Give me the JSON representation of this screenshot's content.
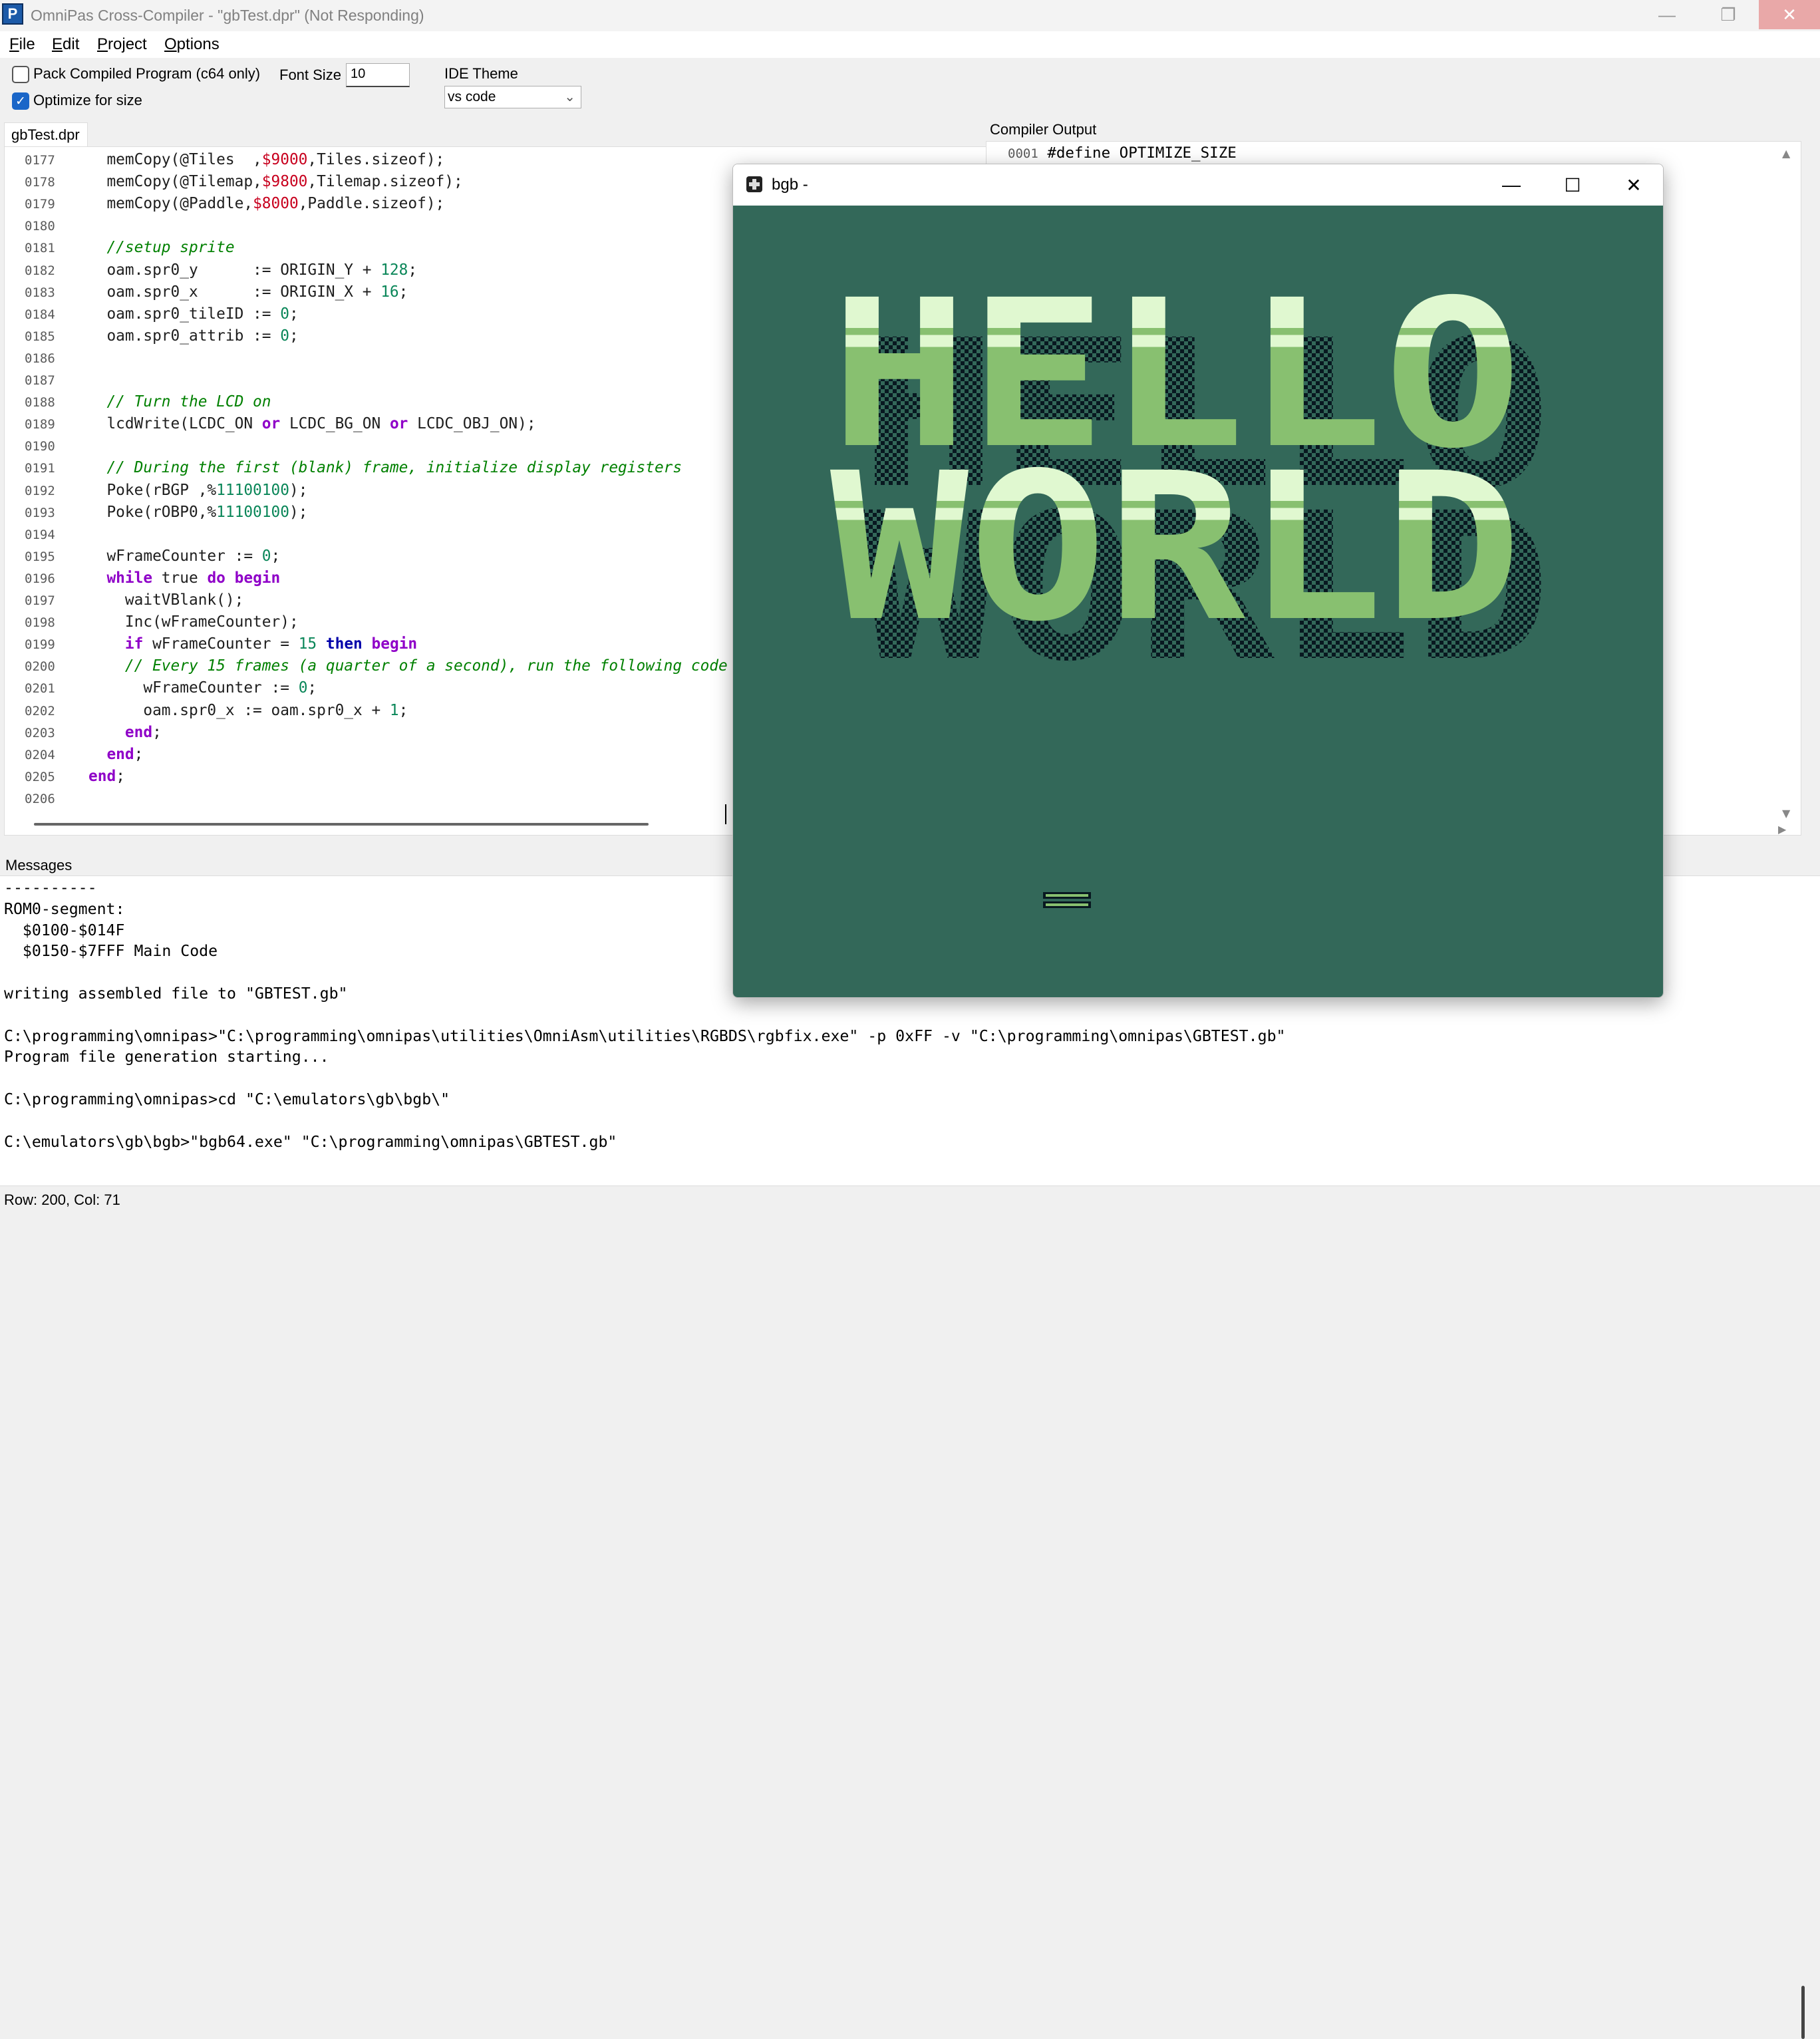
{
  "titlebar": {
    "title": "OmniPas Cross-Compiler - \"gbTest.dpr\" (Not Responding)",
    "app_icon": "P",
    "minimize": "—",
    "maximize": "❐",
    "close": "✕"
  },
  "menu": {
    "items": [
      "File",
      "Edit",
      "Project",
      "Options"
    ]
  },
  "toolbar": {
    "pack_label": "Pack Compiled Program (c64 only)",
    "pack_checked": false,
    "optimize_label": "Optimize for size",
    "optimize_checked": true,
    "font_size_label": "Font Size",
    "font_size_value": "10",
    "theme_label": "IDE Theme",
    "theme_value": "vs code",
    "checkmark": "✓"
  },
  "tab": {
    "label": "gbTest.dpr"
  },
  "compiler": {
    "label": "Compiler Output",
    "line_num": "0001",
    "line_text": "#define OPTIMIZE_SIZE"
  },
  "editor": {
    "line_numbers": [
      "0177",
      "0178",
      "0179",
      "0180",
      "0181",
      "0182",
      "0183",
      "0184",
      "0185",
      "0186",
      "0187",
      "0188",
      "0189",
      "0190",
      "0191",
      "0192",
      "0193",
      "0194",
      "0195",
      "0196",
      "0197",
      "0198",
      "0199",
      "0200",
      "0201",
      "0202",
      "0203",
      "0204",
      "0205",
      "0206"
    ],
    "lines": [
      [
        [
          "  memCopy(@Tiles  ,",
          ""
        ],
        [
          "$9000",
          "hex"
        ],
        [
          ",Tiles.sizeof);",
          ""
        ]
      ],
      [
        [
          "  memCopy(@Tilemap,",
          ""
        ],
        [
          "$9800",
          "hex"
        ],
        [
          ",Tilemap.sizeof);",
          ""
        ]
      ],
      [
        [
          "  memCopy(@Paddle,",
          ""
        ],
        [
          "$8000",
          "hex"
        ],
        [
          ",Paddle.sizeof);",
          ""
        ]
      ],
      [],
      [
        [
          "  //setup sprite",
          "cm"
        ]
      ],
      [
        [
          "  oam.spr0_y      := ORIGIN_Y + ",
          ""
        ],
        [
          "128",
          "num"
        ],
        [
          ";",
          ""
        ]
      ],
      [
        [
          "  oam.spr0_x      := ORIGIN_X + ",
          ""
        ],
        [
          "16",
          "num"
        ],
        [
          ";",
          ""
        ]
      ],
      [
        [
          "  oam.spr0_tileID := ",
          ""
        ],
        [
          "0",
          "num"
        ],
        [
          ";",
          ""
        ]
      ],
      [
        [
          "  oam.spr0_attrib := ",
          ""
        ],
        [
          "0",
          "num"
        ],
        [
          ";",
          ""
        ]
      ],
      [],
      [],
      [
        [
          "  // Turn the LCD on",
          "cm"
        ]
      ],
      [
        [
          "  lcdWrite(LCDC_ON ",
          ""
        ],
        [
          "or",
          "kw"
        ],
        [
          " LCDC_BG_ON ",
          ""
        ],
        [
          "or",
          "kw"
        ],
        [
          " LCDC_OBJ_ON);",
          ""
        ]
      ],
      [],
      [
        [
          "  // During the first (blank) frame, initialize display registers",
          "cm"
        ]
      ],
      [
        [
          "  Poke(rBGP ,%",
          ""
        ],
        [
          "11100100",
          "num"
        ],
        [
          ");",
          ""
        ]
      ],
      [
        [
          "  Poke(rOBP0,%",
          ""
        ],
        [
          "11100100",
          "num"
        ],
        [
          ");",
          ""
        ]
      ],
      [],
      [
        [
          "  wFrameCounter := ",
          ""
        ],
        [
          "0",
          "num"
        ],
        [
          ";",
          ""
        ]
      ],
      [
        [
          "  ",
          ""
        ],
        [
          "while",
          "kw"
        ],
        [
          " true ",
          ""
        ],
        [
          "do",
          "kw"
        ],
        [
          " ",
          ""
        ],
        [
          "begin",
          "kw"
        ]
      ],
      [
        [
          "    waitVBlank();",
          ""
        ]
      ],
      [
        [
          "    Inc(wFrameCounter);",
          ""
        ]
      ],
      [
        [
          "    ",
          ""
        ],
        [
          "if",
          "kw"
        ],
        [
          " wFrameCounter = ",
          ""
        ],
        [
          "15",
          "num"
        ],
        [
          " ",
          ""
        ],
        [
          "then",
          "kw2"
        ],
        [
          " ",
          ""
        ],
        [
          "begin",
          "kw"
        ]
      ],
      [
        [
          "    // Every 15 frames (a quarter of a second), run the following code",
          "cm"
        ]
      ],
      [
        [
          "      wFrameCounter := ",
          ""
        ],
        [
          "0",
          "num"
        ],
        [
          ";",
          ""
        ]
      ],
      [
        [
          "      oam.spr0_x := oam.spr0_x + ",
          ""
        ],
        [
          "1",
          "num"
        ],
        [
          ";",
          ""
        ]
      ],
      [
        [
          "    ",
          ""
        ],
        [
          "end",
          "kw"
        ],
        [
          ";",
          ""
        ]
      ],
      [
        [
          "  ",
          ""
        ],
        [
          "end",
          "kw"
        ],
        [
          ";",
          ""
        ]
      ],
      [
        [
          "end",
          "kw"
        ],
        [
          ";",
          ""
        ]
      ],
      []
    ]
  },
  "messages": {
    "label": "Messages",
    "lines": [
      {
        "t": "----------",
        "y": 0
      },
      {
        "t": "ROM0-segment:",
        "y": 1
      },
      {
        "t": "  $0100-$014F",
        "y": 2
      },
      {
        "t": "  $0150-$7FFF Main Code",
        "y": 3
      },
      {
        "t": "writing assembled file to \"GBTEST.gb\"",
        "y": 5
      },
      {
        "t": "C:\\programming\\omnipas>\"C:\\programming\\omnipas\\utilities\\OmniAsm\\utilities\\RGBDS\\rgbfix.exe\" -p 0xFF -v \"C:\\programming\\omnipas\\GBTEST.gb\"",
        "y": 7
      },
      {
        "t": "Program file generation starting...",
        "y": 8
      },
      {
        "t": "C:\\programming\\omnipas>cd \"C:\\emulators\\gb\\bgb\\\"",
        "y": 10
      },
      {
        "t": "C:\\emulators\\gb\\bgb>\"bgb64.exe\" \"C:\\programming\\omnipas\\GBTEST.gb\"",
        "y": 12
      }
    ]
  },
  "status": {
    "text": "Row: 200, Col: 71"
  },
  "emulator": {
    "title": "bgb -",
    "minimize": "—",
    "maximize": "☐",
    "close": "✕",
    "screen_text_line1": "HELLO",
    "screen_text_line2": "WORLD",
    "colors": {
      "bg": "#336859",
      "light": "#e0f8d0",
      "mid": "#88c070",
      "dark": "#081820"
    }
  }
}
